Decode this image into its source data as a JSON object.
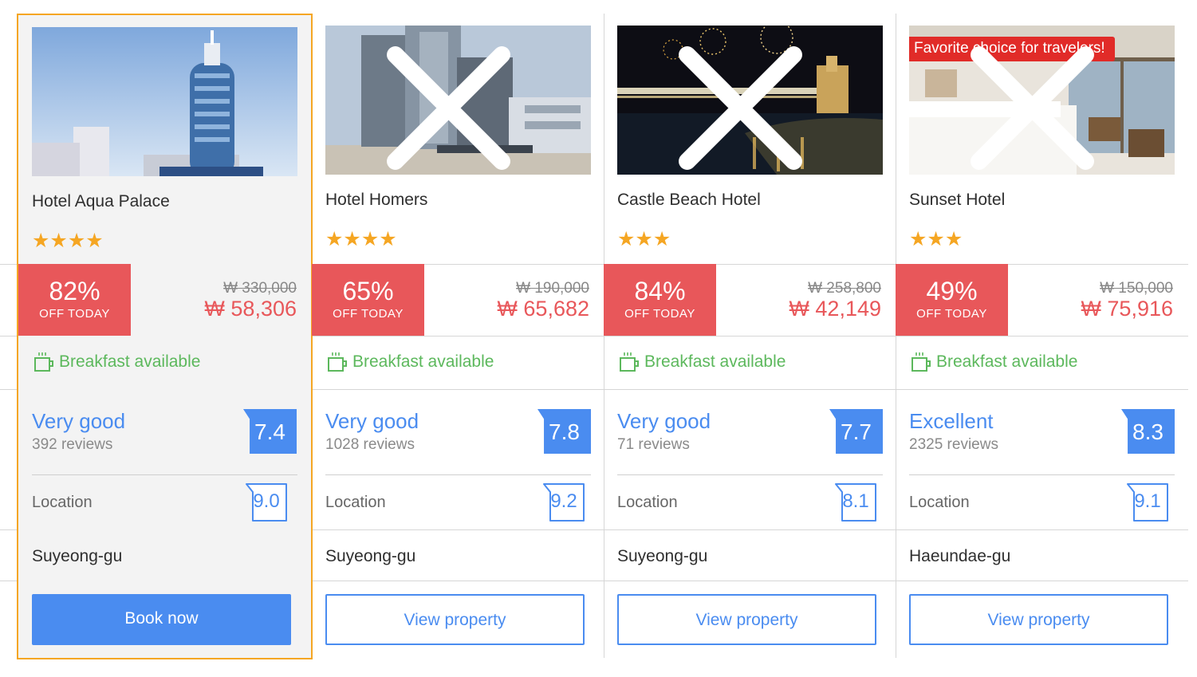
{
  "colors": {
    "accent": "#4a8cf0",
    "discount": "#e8575a",
    "breakfast": "#5cb85c",
    "star": "#f5a623",
    "selected_border": "#f5a623",
    "badge": "#e12b28"
  },
  "hotels": [
    {
      "name": "Hotel Aqua Palace",
      "stars": 4,
      "stars_display": "★★★★",
      "discount_pct": "82%",
      "discount_label": "OFF TODAY",
      "price_old": "₩ 330,000",
      "price_new": "₩ 58,306",
      "breakfast": "Breakfast available",
      "rating_label": "Very good",
      "reviews": "392 reviews",
      "score": "7.4",
      "location_label": "Location",
      "location_score": "9.0",
      "district": "Suyeong-gu",
      "button_label": "Book now",
      "image_icon": "hotel-tower-photo"
    },
    {
      "name": "Hotel Homers",
      "stars": 4,
      "stars_display": "★★★★",
      "discount_pct": "65%",
      "discount_label": "OFF TODAY",
      "price_old": "₩ 190,000",
      "price_new": "₩ 65,682",
      "breakfast": "Breakfast available",
      "rating_label": "Very good",
      "reviews": "1028 reviews",
      "score": "7.8",
      "location_label": "Location",
      "location_score": "9.2",
      "district": "Suyeong-gu",
      "button_label": "View property",
      "image_icon": "hotel-beachfront-photo"
    },
    {
      "name": "Castle Beach Hotel",
      "stars": 3,
      "stars_display": "★★★",
      "discount_pct": "84%",
      "discount_label": "OFF TODAY",
      "price_old": "₩ 258,800",
      "price_new": "₩ 42,149",
      "breakfast": "Breakfast available",
      "rating_label": "Very good",
      "reviews": "71 reviews",
      "score": "7.7",
      "location_label": "Location",
      "location_score": "8.1",
      "district": "Suyeong-gu",
      "button_label": "View property",
      "image_icon": "night-bridge-fireworks-photo"
    },
    {
      "name": "Sunset Hotel",
      "stars": 3,
      "stars_display": "★★★",
      "discount_pct": "49%",
      "discount_label": "OFF TODAY",
      "price_old": "₩ 150,000",
      "price_new": "₩ 75,916",
      "breakfast": "Breakfast available",
      "rating_label": "Excellent",
      "reviews": "2325 reviews",
      "score": "8.3",
      "location_label": "Location",
      "location_score": "9.1",
      "district": "Haeundae-gu",
      "button_label": "View property",
      "badge": "Favorite choice for travelers!",
      "image_icon": "hotel-room-balcony-photo"
    }
  ]
}
